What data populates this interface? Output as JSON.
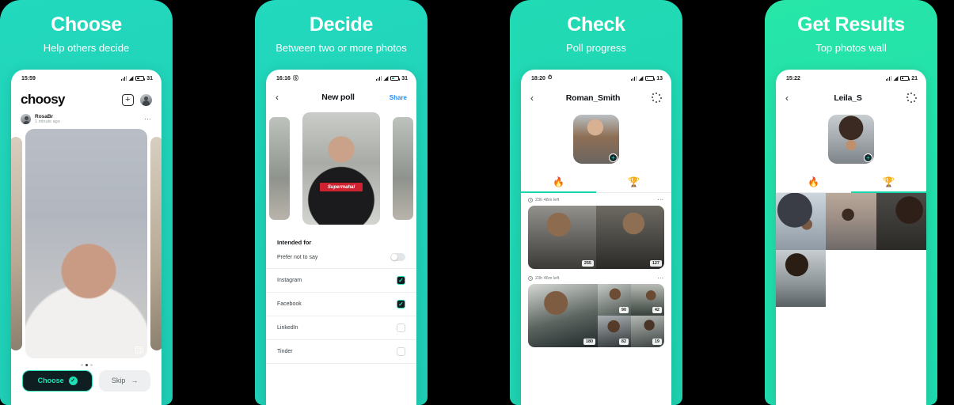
{
  "theme": {
    "teal": "#22d3bb",
    "teal_alt": "#2fe6a8",
    "accent_green": "#18d6ac",
    "dark": "#0f1f21",
    "link_blue": "#1f8ef1"
  },
  "panels": [
    {
      "promo_title": "Choose",
      "promo_sub": "Help others decide",
      "status": {
        "time": "15:59",
        "battery": "31",
        "battery_low": false,
        "has_alarm": false
      },
      "app": {
        "brand": "choosy",
        "add_icon": "plus-icon",
        "avatar_icon": "user-avatar",
        "post": {
          "name": "RosaBr",
          "time": "1 minute ago",
          "more_icon": "more-horizontal-icon"
        },
        "photo_badge_icon": "multi-photo-icon",
        "carousel_dots": 3,
        "carousel_active": 1,
        "choose_label": "Choose",
        "choose_icon": "check-circle-icon",
        "skip_label": "Skip",
        "skip_icon": "arrow-right-icon"
      }
    },
    {
      "promo_title": "Decide",
      "promo_sub": "Between two or more photos",
      "status": {
        "time": "16:16",
        "battery": "31",
        "battery_low": false,
        "has_alarm": true
      },
      "app": {
        "back_icon": "chevron-left-icon",
        "title": "New poll",
        "action_label": "Share",
        "section_title": "Intended for",
        "options": [
          {
            "label": "Prefer not to say",
            "control": "switch",
            "value": false
          },
          {
            "label": "Instagram",
            "control": "checkbox",
            "value": true
          },
          {
            "label": "Facebook",
            "control": "checkbox",
            "value": true
          },
          {
            "label": "LinkedIn",
            "control": "checkbox",
            "value": false
          },
          {
            "label": "Tinder",
            "control": "checkbox",
            "value": false
          }
        ],
        "photo_caption": "Supermahal"
      }
    },
    {
      "promo_title": "Check",
      "promo_sub": "Poll progress",
      "status": {
        "time": "18:20",
        "battery": "13",
        "battery_low": true,
        "has_alarm": true
      },
      "app": {
        "back_icon": "chevron-left-icon",
        "title": "Roman_Smith",
        "menu_icon": "dot-grid-icon",
        "profile_badge_icon": "plus-badge-icon",
        "tabs": [
          {
            "icon": "flame-icon",
            "name": "active-polls",
            "active": true
          },
          {
            "icon": "trophy-icon",
            "name": "results",
            "active": false
          }
        ],
        "polls": [
          {
            "time_left": "23h 48m left",
            "more_icon": "more-horizontal-icon",
            "photos": [
              {
                "votes": "255"
              },
              {
                "votes": "127"
              }
            ]
          },
          {
            "time_left": "23h 46m left",
            "more_icon": "more-horizontal-icon",
            "photos": [
              {
                "votes": "180"
              },
              {
                "votes": "90"
              },
              {
                "votes": "42"
              },
              {
                "votes": "82"
              },
              {
                "votes": "19"
              }
            ]
          }
        ]
      }
    },
    {
      "promo_title": "Get Results",
      "promo_sub": "Top photos wall",
      "status": {
        "time": "15:22",
        "battery": "21",
        "battery_low": false,
        "has_alarm": false
      },
      "app": {
        "back_icon": "chevron-left-icon",
        "title": "Leila_S",
        "menu_icon": "dot-grid-icon",
        "profile_badge_icon": "plus-badge-icon",
        "tabs": [
          {
            "icon": "flame-icon",
            "name": "active-polls",
            "active": false
          },
          {
            "icon": "trophy-icon",
            "name": "results",
            "active": true
          }
        ],
        "wall": [
          {
            "name": "photo-umbrella"
          },
          {
            "name": "photo-street"
          },
          {
            "name": "photo-desk"
          },
          {
            "name": "photo-coffee"
          }
        ]
      }
    }
  ]
}
